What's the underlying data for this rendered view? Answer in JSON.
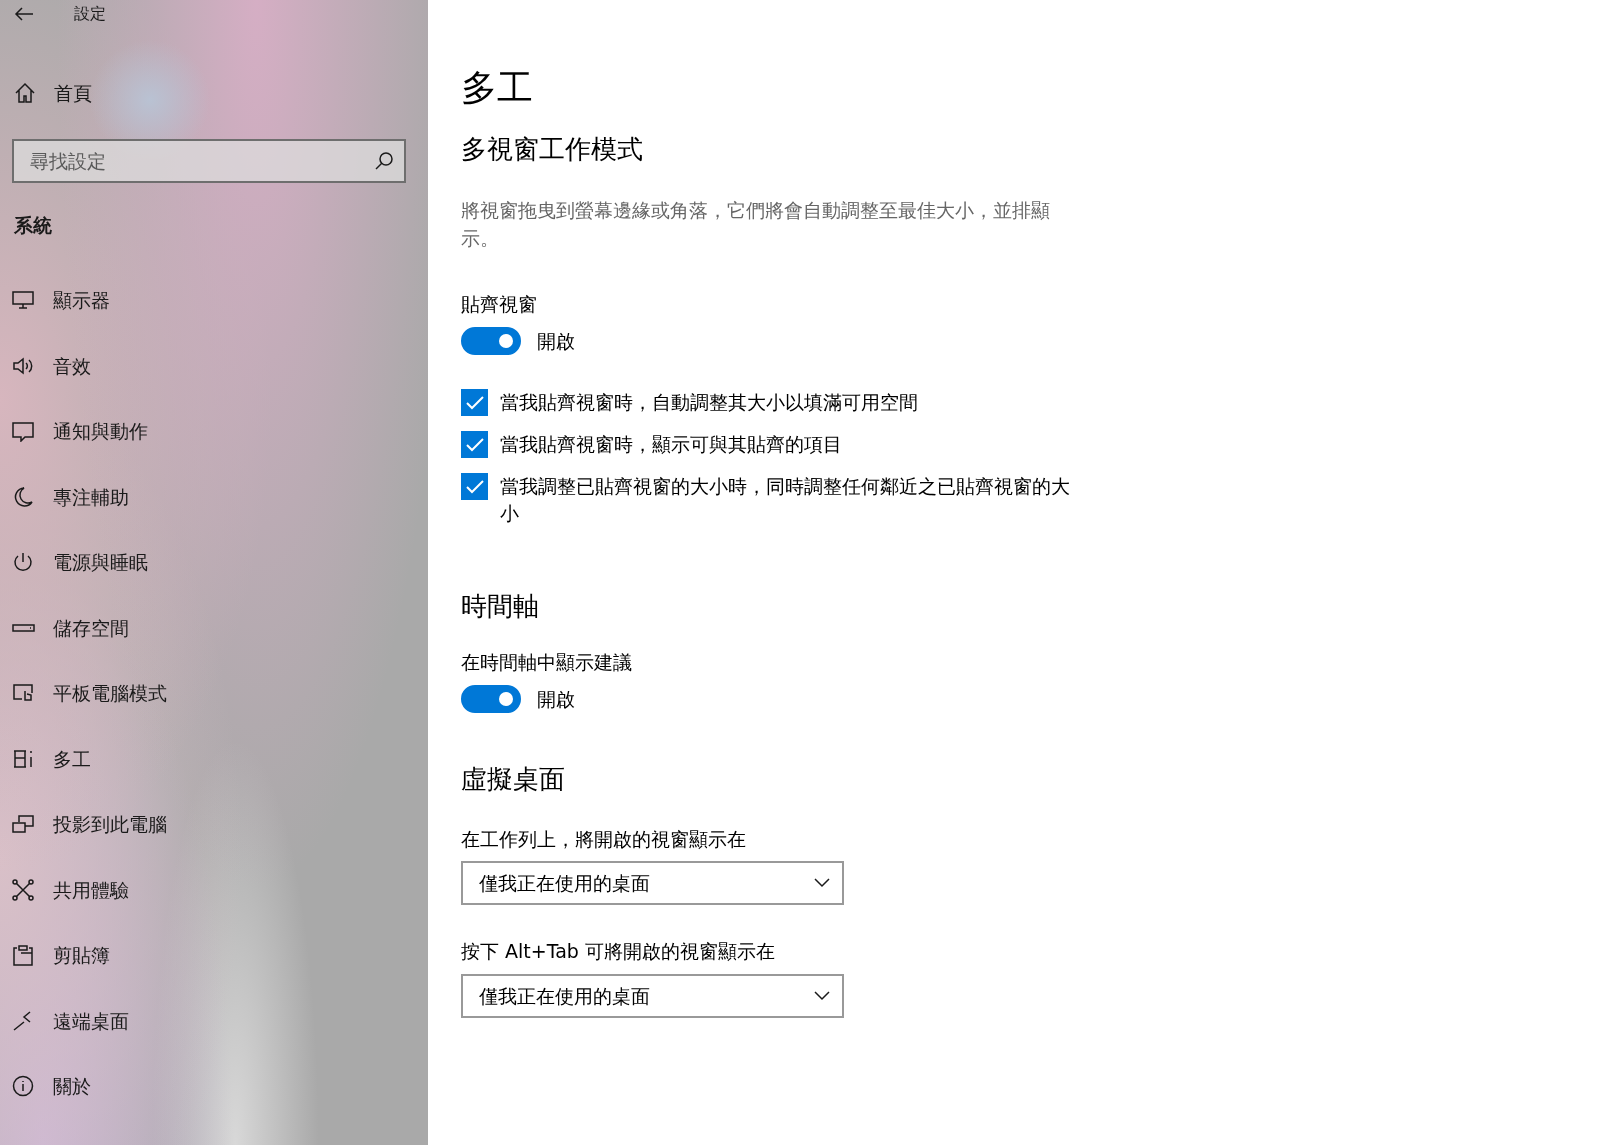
{
  "window": {
    "title": "設定"
  },
  "sidebar": {
    "home": "首頁",
    "search": {
      "placeholder": "尋找設定"
    },
    "section": "系統",
    "items": [
      {
        "label": "顯示器"
      },
      {
        "label": "音效"
      },
      {
        "label": "通知與動作"
      },
      {
        "label": "專注輔助"
      },
      {
        "label": "電源與睡眠"
      },
      {
        "label": "儲存空間"
      },
      {
        "label": "平板電腦模式"
      },
      {
        "label": "多工"
      },
      {
        "label": "投影到此電腦"
      },
      {
        "label": "共用體驗"
      },
      {
        "label": "剪貼簿"
      },
      {
        "label": "遠端桌面"
      },
      {
        "label": "關於"
      }
    ]
  },
  "page": {
    "title": "多工",
    "snap": {
      "heading": "多視窗工作模式",
      "description": "將視窗拖曳到螢幕邊緣或角落，它們將會自動調整至最佳大小，並排顯示。",
      "setting": "貼齊視窗",
      "toggle": {
        "on": true,
        "label": "開啟"
      },
      "checkboxes": [
        {
          "label": "當我貼齊視窗時，自動調整其大小以填滿可用空間",
          "checked": true
        },
        {
          "label": "當我貼齊視窗時，顯示可與其貼齊的項目",
          "checked": true
        },
        {
          "label": "當我調整已貼齊視窗的大小時，同時調整任何鄰近之已貼齊視窗的大小",
          "checked": true
        }
      ]
    },
    "timeline": {
      "heading": "時間軸",
      "setting": "在時間軸中顯示建議",
      "toggle": {
        "on": true,
        "label": "開啟"
      }
    },
    "desktops": {
      "heading": "虛擬桌面",
      "dropdowns": [
        {
          "label": "在工作列上，將開啟的視窗顯示在",
          "value": "僅我正在使用的桌面"
        },
        {
          "label": "按下 Alt+Tab 可將開啟的視窗顯示在",
          "value": "僅我正在使用的桌面"
        }
      ]
    }
  }
}
